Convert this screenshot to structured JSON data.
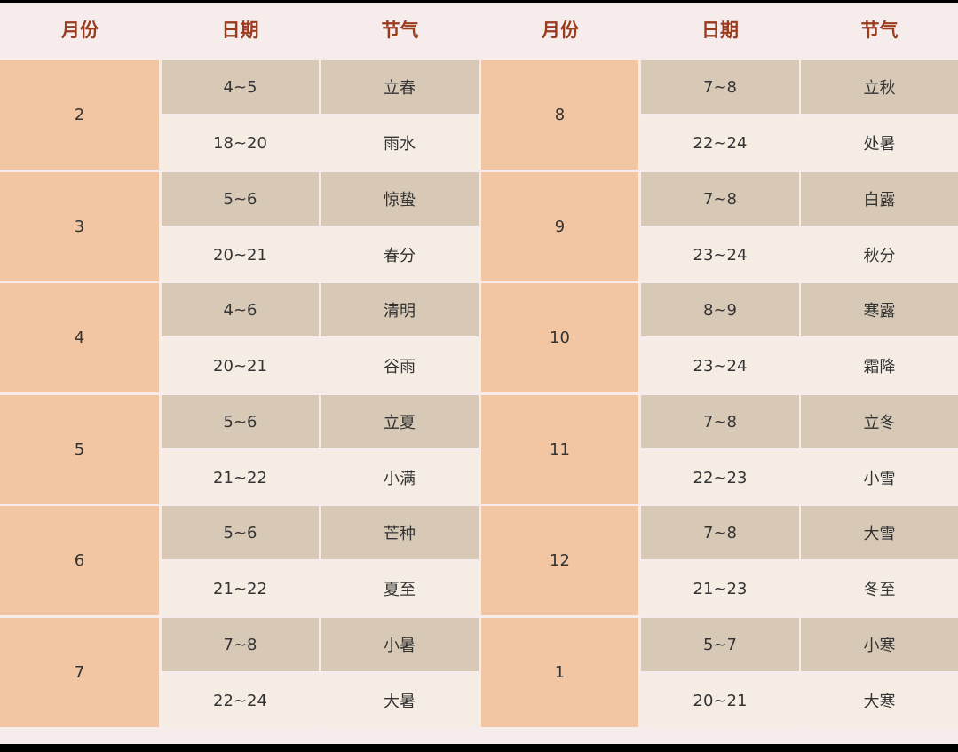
{
  "headers": [
    "月份",
    "日期",
    "节气",
    "月份",
    "日期",
    "节气"
  ],
  "left": [
    {
      "month": "2",
      "rows": [
        {
          "date": "4~5",
          "term": "立春"
        },
        {
          "date": "18~20",
          "term": "雨水"
        }
      ]
    },
    {
      "month": "3",
      "rows": [
        {
          "date": "5~6",
          "term": "惊蛰"
        },
        {
          "date": "20~21",
          "term": "春分"
        }
      ]
    },
    {
      "month": "4",
      "rows": [
        {
          "date": "4~6",
          "term": "清明"
        },
        {
          "date": "20~21",
          "term": "谷雨"
        }
      ]
    },
    {
      "month": "5",
      "rows": [
        {
          "date": "5~6",
          "term": "立夏"
        },
        {
          "date": "21~22",
          "term": "小满"
        }
      ]
    },
    {
      "month": "6",
      "rows": [
        {
          "date": "5~6",
          "term": "芒种"
        },
        {
          "date": "21~22",
          "term": "夏至"
        }
      ]
    },
    {
      "month": "7",
      "rows": [
        {
          "date": "7~8",
          "term": "小暑"
        },
        {
          "date": "22~24",
          "term": "大暑"
        }
      ]
    }
  ],
  "right": [
    {
      "month": "8",
      "rows": [
        {
          "date": "7~8",
          "term": "立秋"
        },
        {
          "date": "22~24",
          "term": "处暑"
        }
      ]
    },
    {
      "month": "9",
      "rows": [
        {
          "date": "7~8",
          "term": "白露"
        },
        {
          "date": "23~24",
          "term": "秋分"
        }
      ]
    },
    {
      "month": "10",
      "rows": [
        {
          "date": "8~9",
          "term": "寒露"
        },
        {
          "date": "23~24",
          "term": "霜降"
        }
      ]
    },
    {
      "month": "11",
      "rows": [
        {
          "date": "7~8",
          "term": "立冬"
        },
        {
          "date": "22~23",
          "term": "小雪"
        }
      ]
    },
    {
      "month": "12",
      "rows": [
        {
          "date": "7~8",
          "term": "大雪"
        },
        {
          "date": "21~23",
          "term": "冬至"
        }
      ]
    },
    {
      "month": "1",
      "rows": [
        {
          "date": "5~7",
          "term": "小寒"
        },
        {
          "date": "20~21",
          "term": "大寒"
        }
      ]
    }
  ],
  "colors": {
    "header_text": "#9a3b1d",
    "month_bg": "#f2c6a2",
    "dark_row_bg": "#d8c9b7",
    "light_row_bg": "#f5ede3",
    "page_bg": "#f5eceb"
  }
}
